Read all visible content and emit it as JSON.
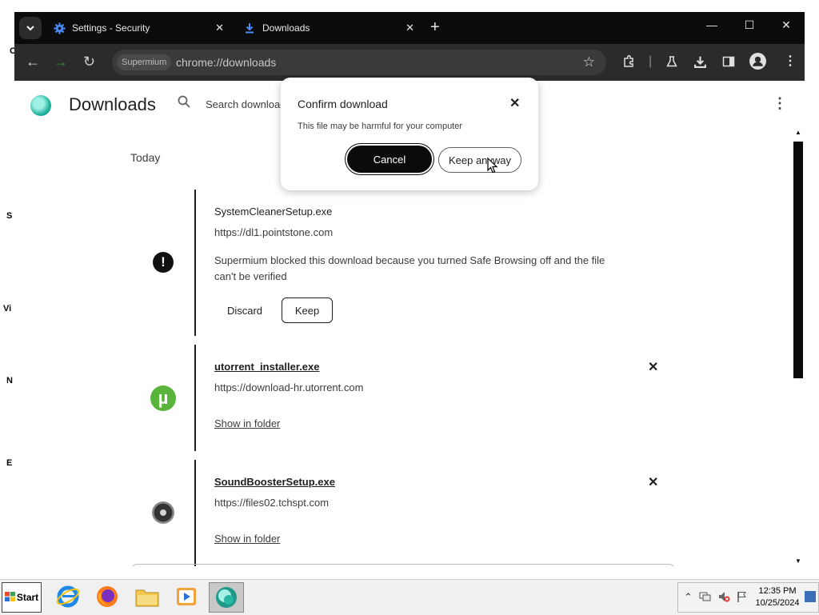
{
  "desktop_fragments": [
    "C",
    "S",
    "Vi",
    "N",
    "E"
  ],
  "tabs": [
    {
      "title": "Settings - Security",
      "icon": "gear-icon"
    },
    {
      "title": "Downloads",
      "icon": "download-icon"
    }
  ],
  "omnibox": {
    "chip": "Supermium",
    "url": "chrome://downloads"
  },
  "page": {
    "title": "Downloads",
    "search_placeholder": "Search downloads",
    "section_today": "Today"
  },
  "downloads": [
    {
      "name": "SystemCleanerSetup.exe",
      "url": "https://dl1.pointstone.com",
      "message": "Supermium blocked this download because you turned Safe Browsing off and the file can't be verified",
      "discard_label": "Discard",
      "keep_label": "Keep",
      "icon": "warning-icon"
    },
    {
      "name": "utorrent_installer.exe",
      "url": "https://download-hr.utorrent.com",
      "show_in_folder": "Show in folder",
      "icon": "utorrent-icon"
    },
    {
      "name": "SoundBoosterSetup.exe",
      "url": "https://files02.tchspt.com",
      "show_in_folder": "Show in folder",
      "icon": "speaker-icon"
    }
  ],
  "dialog": {
    "title": "Confirm download",
    "message": "This file may be harmful for your computer",
    "cancel_label": "Cancel",
    "keep_label": "Keep anyway"
  },
  "taskbar": {
    "start_label": "Start",
    "time": "12:35 PM",
    "date": "10/25/2024"
  }
}
